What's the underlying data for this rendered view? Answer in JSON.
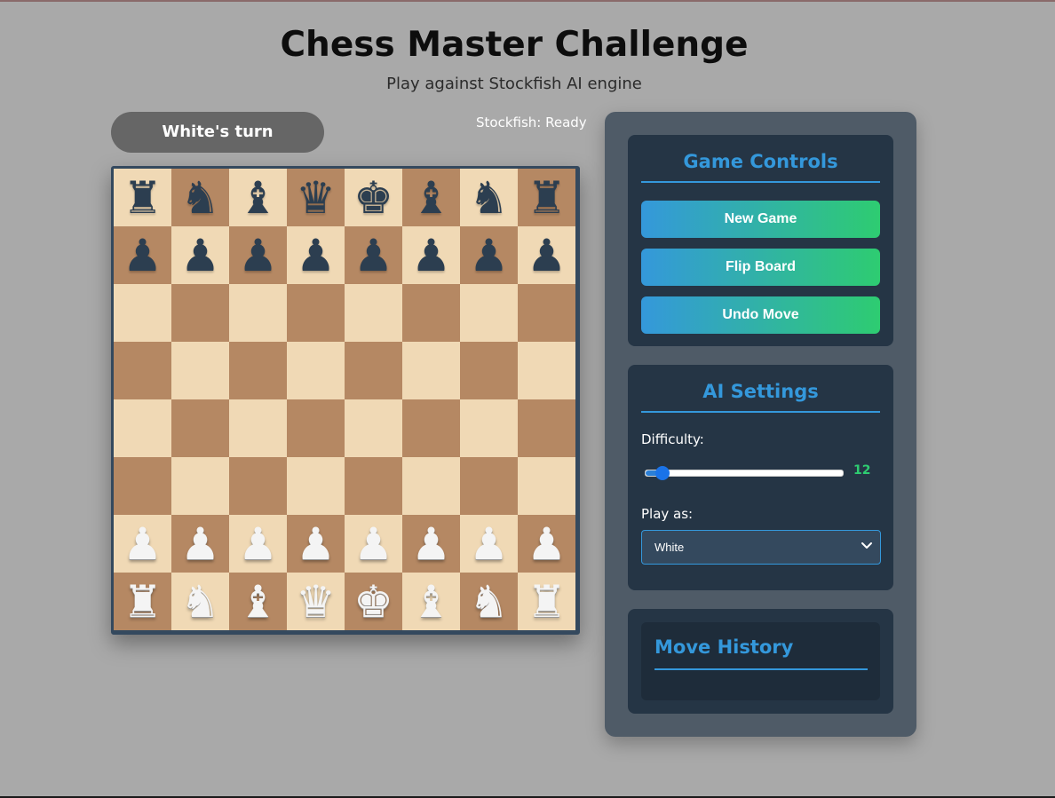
{
  "header": {
    "title": "Chess Master Challenge",
    "subtitle": "Play against Stockfish AI engine"
  },
  "status": {
    "turn": "White's turn",
    "engine": "Stockfish: Ready"
  },
  "board": {
    "rows": [
      [
        {
          "g": "♜",
          "c": "black"
        },
        {
          "g": "♞",
          "c": "black"
        },
        {
          "g": "♝",
          "c": "black"
        },
        {
          "g": "♛",
          "c": "black"
        },
        {
          "g": "♚",
          "c": "black"
        },
        {
          "g": "♝",
          "c": "black"
        },
        {
          "g": "♞",
          "c": "black"
        },
        {
          "g": "♜",
          "c": "black"
        }
      ],
      [
        {
          "g": "♟",
          "c": "black"
        },
        {
          "g": "♟",
          "c": "black"
        },
        {
          "g": "♟",
          "c": "black"
        },
        {
          "g": "♟",
          "c": "black"
        },
        {
          "g": "♟",
          "c": "black"
        },
        {
          "g": "♟",
          "c": "black"
        },
        {
          "g": "♟",
          "c": "black"
        },
        {
          "g": "♟",
          "c": "black"
        }
      ],
      [
        null,
        null,
        null,
        null,
        null,
        null,
        null,
        null
      ],
      [
        null,
        null,
        null,
        null,
        null,
        null,
        null,
        null
      ],
      [
        null,
        null,
        null,
        null,
        null,
        null,
        null,
        null
      ],
      [
        null,
        null,
        null,
        null,
        null,
        null,
        null,
        null
      ],
      [
        {
          "g": "♟",
          "c": "white"
        },
        {
          "g": "♟",
          "c": "white"
        },
        {
          "g": "♟",
          "c": "white"
        },
        {
          "g": "♟",
          "c": "white"
        },
        {
          "g": "♟",
          "c": "white"
        },
        {
          "g": "♟",
          "c": "white"
        },
        {
          "g": "♟",
          "c": "white"
        },
        {
          "g": "♟",
          "c": "white"
        }
      ],
      [
        {
          "g": "♜",
          "c": "white"
        },
        {
          "g": "♞",
          "c": "white"
        },
        {
          "g": "♝",
          "c": "white"
        },
        {
          "g": "♛",
          "c": "white"
        },
        {
          "g": "♚",
          "c": "white"
        },
        {
          "g": "♝",
          "c": "white"
        },
        {
          "g": "♞",
          "c": "white"
        },
        {
          "g": "♜",
          "c": "white"
        }
      ]
    ],
    "colors": {
      "light": "#f0d9b5",
      "dark": "#b58863",
      "black_piece": "#2c3e50",
      "white_piece": "#f4f4f4"
    }
  },
  "controls": {
    "title": "Game Controls",
    "new_game": "New Game",
    "flip_board": "Flip Board",
    "undo_move": "Undo Move"
  },
  "ai_settings": {
    "title": "AI Settings",
    "difficulty_label": "Difficulty:",
    "difficulty_value": "12",
    "difficulty_min": 0,
    "difficulty_max": 20,
    "play_as_label": "Play as:",
    "play_as_value": "White"
  },
  "history": {
    "title": "Move History"
  },
  "theme": {
    "accent": "#3498db",
    "accent_green": "#2ecc71",
    "panel": "#4f5b67",
    "card": "#253545"
  }
}
